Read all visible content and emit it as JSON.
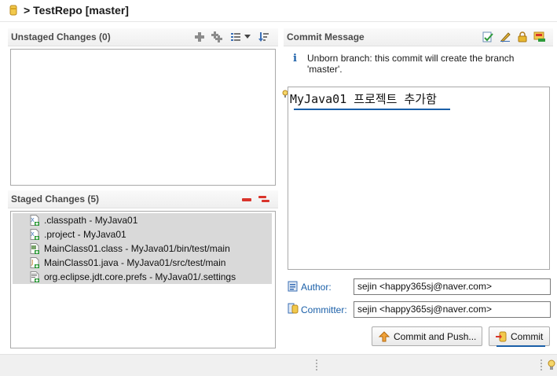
{
  "title": {
    "arrow": ">",
    "repo": "TestRepo [master]"
  },
  "unstaged": {
    "title": "Unstaged Changes (0)"
  },
  "staged": {
    "title": "Staged Changes (5)",
    "files": [
      {
        "label": ".classpath - MyJava01",
        "icon": "xml-file-added-icon"
      },
      {
        "label": ".project - MyJava01",
        "icon": "xml-file-added-icon"
      },
      {
        "label": "MainClass01.class - MyJava01/bin/test/main",
        "icon": "class-file-added-icon"
      },
      {
        "label": "MainClass01.java - MyJava01/src/test/main",
        "icon": "java-file-added-icon"
      },
      {
        "label": "org.eclipse.jdt.core.prefs - MyJava01/.settings",
        "icon": "text-file-added-icon"
      }
    ]
  },
  "commit": {
    "title": "Commit Message",
    "info_line1": "Unborn branch: this commit will create the branch",
    "info_line2": "'master'.",
    "message": "MyJava01 프로젝트 추가함",
    "author_label": "Author:",
    "author_value": "sejin <happy365sj@naver.com>",
    "committer_label": "Committer:",
    "committer_value": "sejin <happy365sj@naver.com>",
    "commit_push_label": "Commit and Push...",
    "commit_label": "Commit"
  },
  "colors": {
    "accent_blue": "#1a5fa8",
    "remove_red": "#d9342b",
    "staged_row_bg": "#d9d9d9"
  }
}
